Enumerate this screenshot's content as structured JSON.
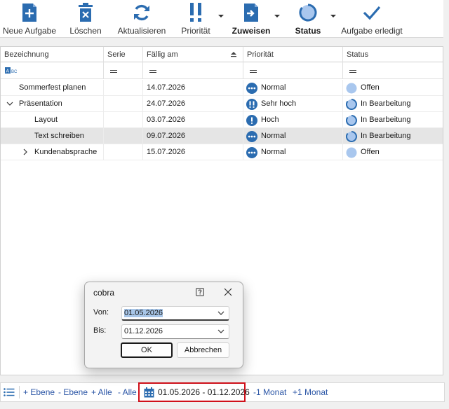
{
  "toolbar": {
    "new_task": "Neue Aufgabe",
    "delete": "Löschen",
    "refresh": "Aktualisieren",
    "priority": "Priorität",
    "assign": "Zuweisen",
    "status": "Status",
    "task_done": "Aufgabe erledigt"
  },
  "columns": {
    "name": "Bezeichnung",
    "series": "Serie",
    "due": "Fällig am",
    "priority": "Priorität",
    "status": "Status"
  },
  "rows": [
    {
      "name": "Sommerfest planen",
      "due": "14.07.2026",
      "priority": "Normal",
      "status": "Offen"
    },
    {
      "name": "Präsentation",
      "due": "24.07.2026",
      "priority": "Sehr hoch",
      "status": "In Bearbeitung"
    },
    {
      "name": "Layout",
      "due": "03.07.2026",
      "priority": "Hoch",
      "status": "In Bearbeitung"
    },
    {
      "name": "Text schreiben",
      "due": "09.07.2026",
      "priority": "Normal",
      "status": "In Bearbeitung"
    },
    {
      "name": "Kundenabsprache",
      "due": "15.07.2026",
      "priority": "Normal",
      "status": "Offen"
    }
  ],
  "bottom": {
    "add_level": "+ Ebene",
    "remove_level": "- Ebene",
    "add_all": "+ Alle",
    "remove_all": "- Alle",
    "date_range": "01.05.2026 - 01.12.2026",
    "minus_month": "-1 Monat",
    "plus_month": "+1 Monat"
  },
  "dialog": {
    "title": "cobra",
    "from_label": "Von:",
    "from_value": "01.05.2026",
    "to_label": "Bis:",
    "to_value": "01.12.2026",
    "ok": "OK",
    "cancel": "Abbrechen"
  },
  "colors": {
    "accent_blue": "#2b6cb0",
    "highlight_red": "#d0101a",
    "status_open": "#a9c7ee"
  }
}
